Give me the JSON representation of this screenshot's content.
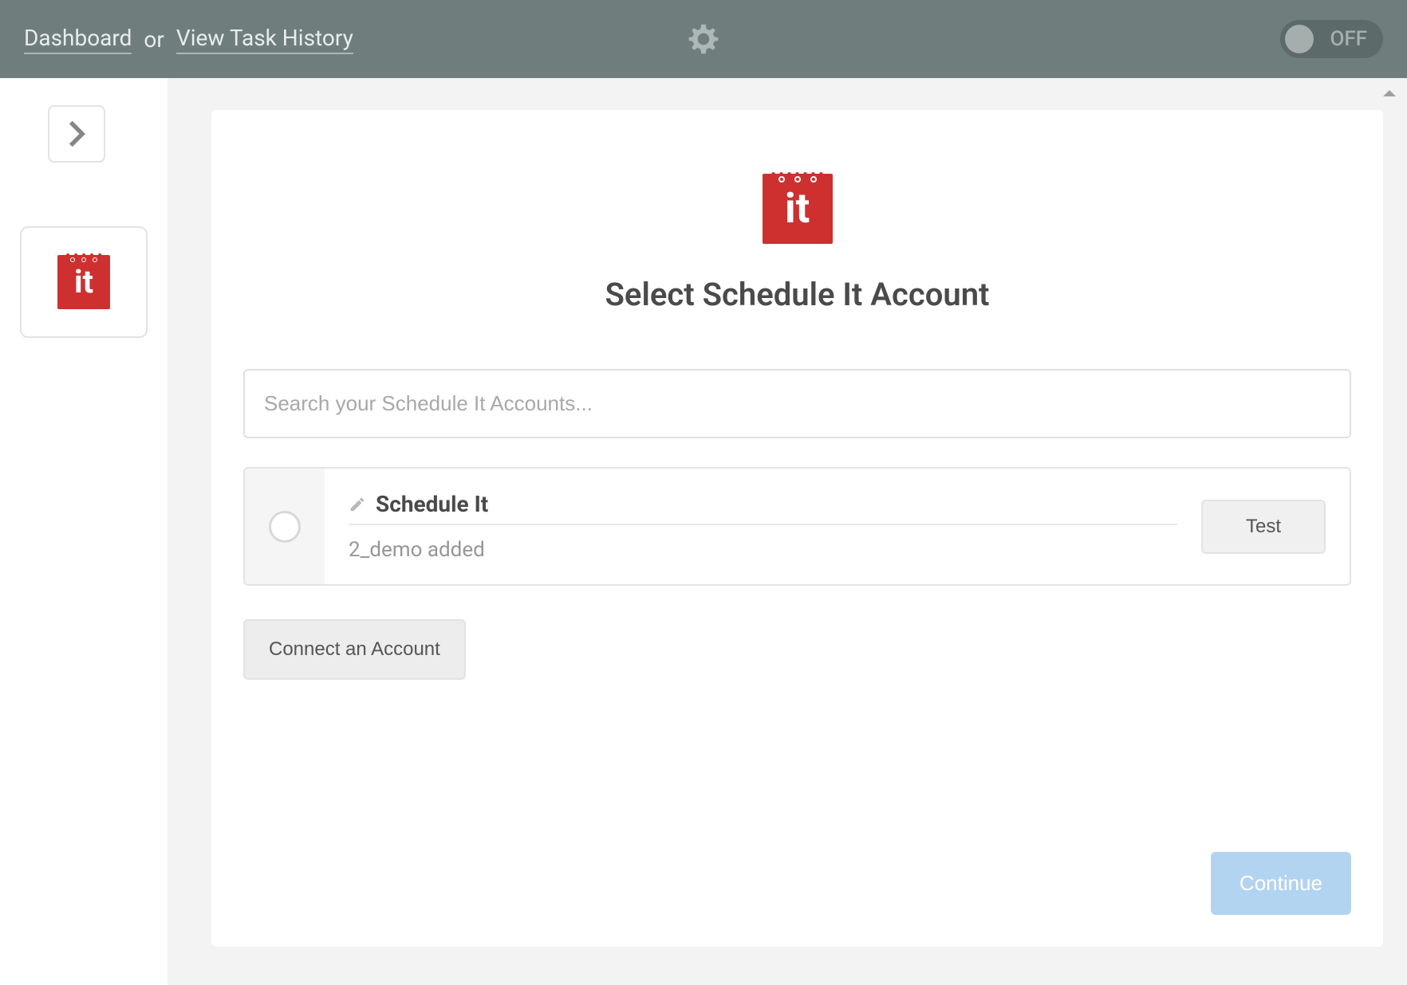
{
  "header": {
    "dashboard_link": "Dashboard",
    "or_text": "or",
    "history_link": "View Task History",
    "toggle_label": "OFF"
  },
  "panel": {
    "title": "Select Schedule It Account",
    "search_placeholder": "Search your Schedule It Accounts...",
    "logo_text": "it"
  },
  "account": {
    "name": "Schedule It",
    "subtitle": "2_demo added",
    "test_label": "Test"
  },
  "actions": {
    "connect_label": "Connect an Account",
    "continue_label": "Continue"
  },
  "sidebar": {
    "logo_text": "it"
  }
}
